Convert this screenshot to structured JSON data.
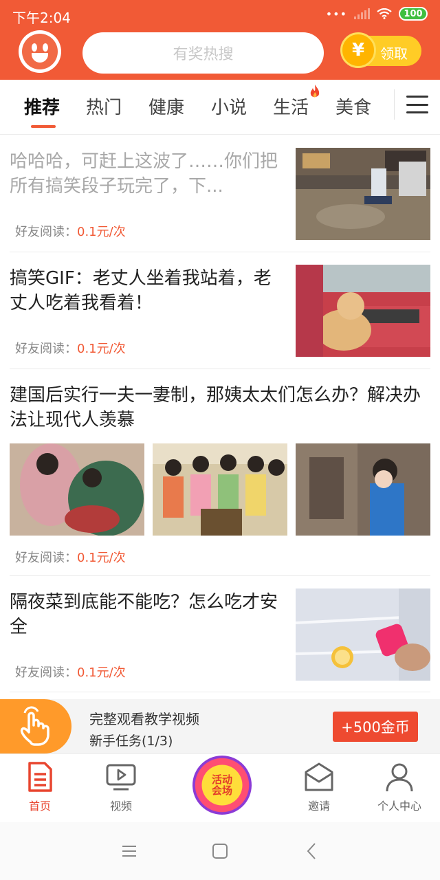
{
  "status_bar": {
    "time": "下午2:04",
    "battery": "100"
  },
  "header": {
    "search_placeholder": "有奖热搜",
    "reward_label": "领取",
    "coin_symbol": "¥"
  },
  "tabs": [
    {
      "label": "推荐",
      "active": true
    },
    {
      "label": "热门"
    },
    {
      "label": "健康"
    },
    {
      "label": "小说"
    },
    {
      "label": "生活",
      "hot": true
    },
    {
      "label": "美食"
    }
  ],
  "articles": [
    {
      "title": "哈哈哈，可赶上这波了……你们把所有搞笑段子玩完了，下...",
      "read_label": "好友阅读：",
      "price": "0.1元/次",
      "read": true
    },
    {
      "title": "搞笑GIF：老丈人坐着我站着，老丈人吃着我看着！",
      "read_label": "好友阅读：",
      "price": "0.1元/次"
    },
    {
      "title": "建国后实行一夫一妻制，那姨太太们怎么办？解决办法让现代人羡慕",
      "read_label": "好友阅读：",
      "price": "0.1元/次"
    },
    {
      "title": "隔夜菜到底能不能吃？怎么吃才安全",
      "read_label": "好友阅读：",
      "price": "0.1元/次"
    }
  ],
  "task_banner": {
    "title": "完整观看教学视频",
    "subtitle": "新手任务(1/3)",
    "reward_button": "+500金币"
  },
  "bottom_nav": {
    "home": "首页",
    "video": "视频",
    "event_line1": "活动",
    "event_line2": "会场",
    "invite": "邀请",
    "profile": "个人中心"
  },
  "colors": {
    "brand": "#f15a36",
    "price": "#f15a36",
    "task_button": "#ee4a30"
  }
}
